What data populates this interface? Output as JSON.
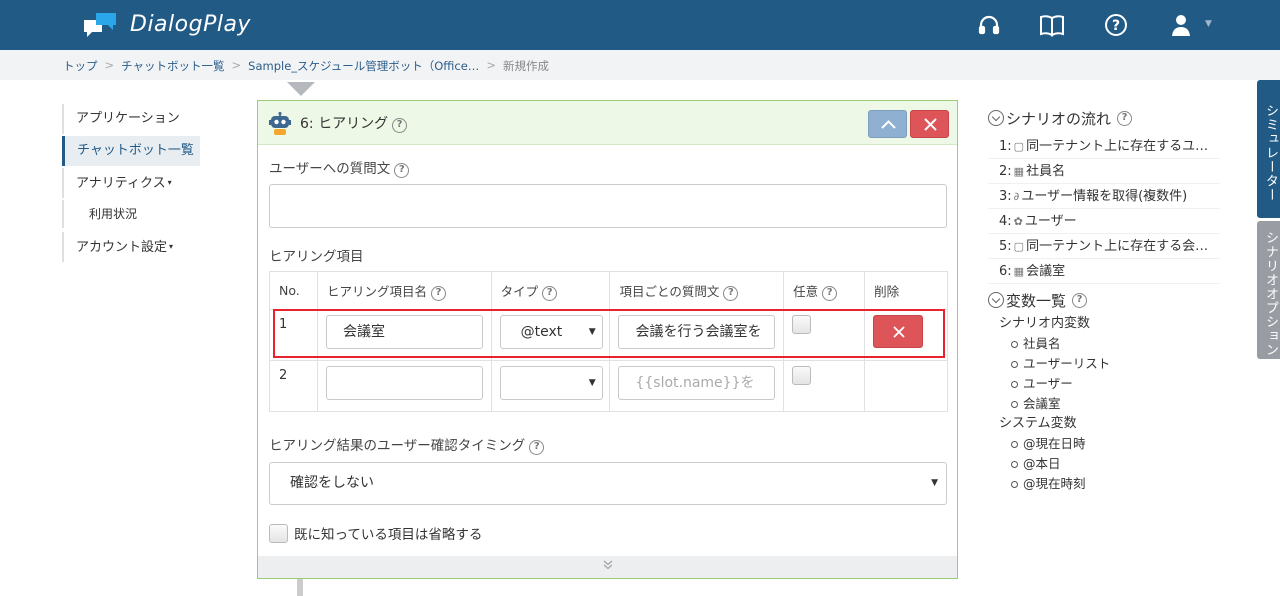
{
  "app": {
    "name": "DialogPlay"
  },
  "breadcrumb": [
    "トップ",
    "チャットボット一覧",
    "Sample_スケジュール管理ボット（Office…",
    "新規作成"
  ],
  "leftnav": {
    "items": [
      {
        "label": "アプリケーション"
      },
      {
        "label": "チャットボット一覧",
        "active": true
      },
      {
        "label": "アナリティクス",
        "caret": "▾"
      },
      {
        "label": "利用状況",
        "sub": true
      },
      {
        "label": "アカウント設定",
        "caret": "▾"
      }
    ]
  },
  "panel": {
    "title": "6: ヒアリング",
    "question_label": "ユーザーへの質問文",
    "question_value": "",
    "items_label": "ヒアリング項目",
    "table": {
      "headers": {
        "no": "No.",
        "name": "ヒアリング項目名",
        "type": "タイプ",
        "question": "項目ごとの質問文",
        "optional": "任意",
        "delete": "削除"
      },
      "rows": [
        {
          "no": "1",
          "name": "会議室",
          "type": "@text",
          "question": "会議を行う会議室を",
          "optional": false
        },
        {
          "no": "2",
          "name": "",
          "type": "",
          "question_placeholder": "{{slot.name}}を",
          "optional": false
        }
      ]
    },
    "confirm_label": "ヒアリング結果のユーザー確認タイミング",
    "confirm_value": "確認をしない",
    "skip_label": "既に知っている項目は省略する",
    "footer_icon": "double-chevron-down-icon"
  },
  "rightpanel": {
    "flow_title": "シナリオの流れ",
    "flow": [
      {
        "num": "1:",
        "icon": "speech-icon",
        "label": "同一テナント上に存在するユ…"
      },
      {
        "num": "2:",
        "icon": "calendar-icon",
        "label": "社員名"
      },
      {
        "num": "3:",
        "icon": "link-icon",
        "label": "ユーザー情報を取得(複数件)"
      },
      {
        "num": "4:",
        "icon": "gear-icon",
        "label": "ユーザー"
      },
      {
        "num": "5:",
        "icon": "speech-icon",
        "label": "同一テナント上に存在する会…"
      },
      {
        "num": "6:",
        "icon": "calendar-icon",
        "label": "会議室"
      }
    ],
    "vars_title": "変数一覧",
    "scenario_vars_label": "シナリオ内変数",
    "scenario_vars": [
      "社員名",
      "ユーザーリスト",
      "ユーザー",
      "会議室"
    ],
    "system_vars_label": "システム変数",
    "system_vars": [
      "@現在日時",
      "@本日",
      "@現在時刻"
    ]
  },
  "sidetabs": {
    "simulator": "シミュレーター",
    "options": "シナリオオプション"
  },
  "colors": {
    "header": "#225a86",
    "accent_red": "#de5559",
    "panel_border": "#9ccc7a",
    "highlight": "#e8232e"
  }
}
